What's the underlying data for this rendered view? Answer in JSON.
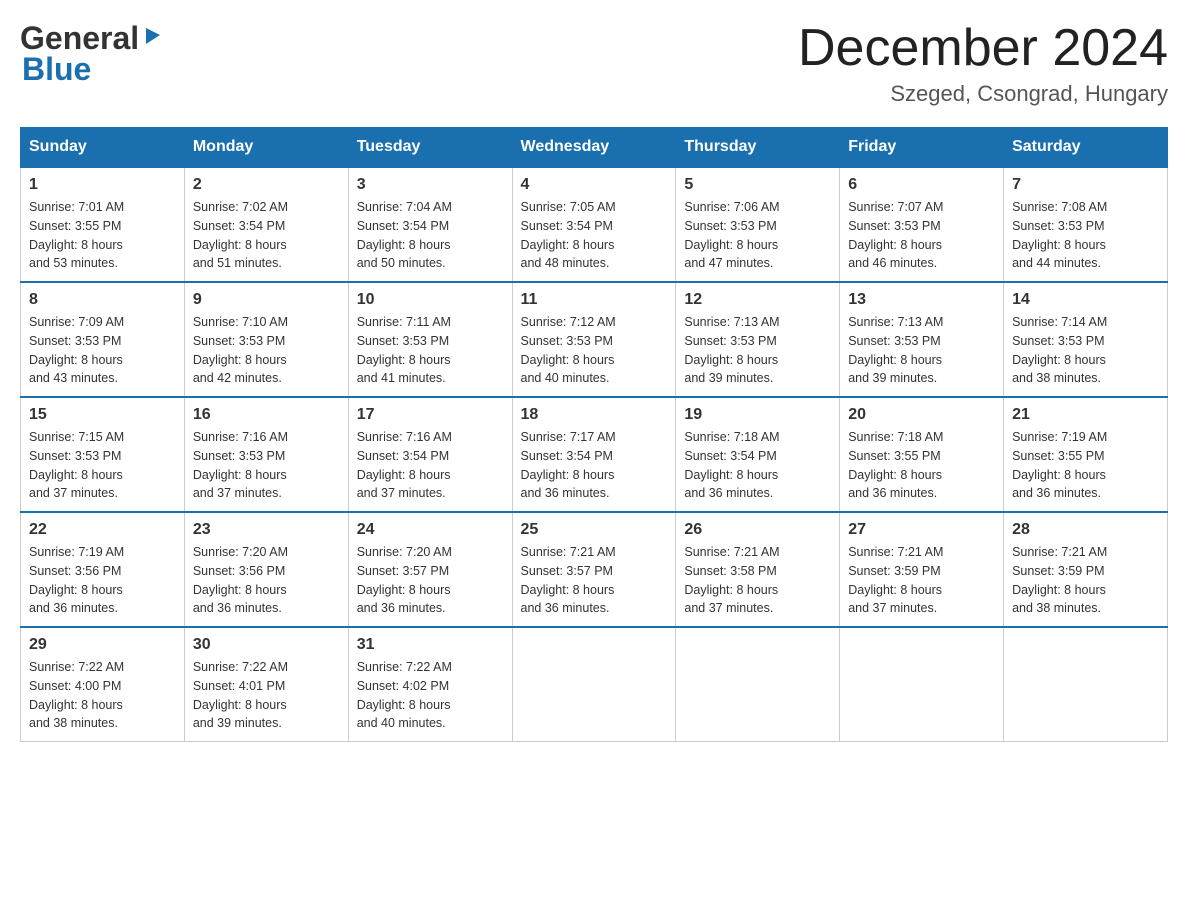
{
  "logo": {
    "general": "General",
    "blue": "Blue",
    "arrow": "▶"
  },
  "title": "December 2024",
  "location": "Szeged, Csongrad, Hungary",
  "days_header": [
    "Sunday",
    "Monday",
    "Tuesday",
    "Wednesday",
    "Thursday",
    "Friday",
    "Saturday"
  ],
  "weeks": [
    [
      {
        "date": "1",
        "sunrise": "7:01 AM",
        "sunset": "3:55 PM",
        "daylight": "8 hours and 53 minutes."
      },
      {
        "date": "2",
        "sunrise": "7:02 AM",
        "sunset": "3:54 PM",
        "daylight": "8 hours and 51 minutes."
      },
      {
        "date": "3",
        "sunrise": "7:04 AM",
        "sunset": "3:54 PM",
        "daylight": "8 hours and 50 minutes."
      },
      {
        "date": "4",
        "sunrise": "7:05 AM",
        "sunset": "3:54 PM",
        "daylight": "8 hours and 48 minutes."
      },
      {
        "date": "5",
        "sunrise": "7:06 AM",
        "sunset": "3:53 PM",
        "daylight": "8 hours and 47 minutes."
      },
      {
        "date": "6",
        "sunrise": "7:07 AM",
        "sunset": "3:53 PM",
        "daylight": "8 hours and 46 minutes."
      },
      {
        "date": "7",
        "sunrise": "7:08 AM",
        "sunset": "3:53 PM",
        "daylight": "8 hours and 44 minutes."
      }
    ],
    [
      {
        "date": "8",
        "sunrise": "7:09 AM",
        "sunset": "3:53 PM",
        "daylight": "8 hours and 43 minutes."
      },
      {
        "date": "9",
        "sunrise": "7:10 AM",
        "sunset": "3:53 PM",
        "daylight": "8 hours and 42 minutes."
      },
      {
        "date": "10",
        "sunrise": "7:11 AM",
        "sunset": "3:53 PM",
        "daylight": "8 hours and 41 minutes."
      },
      {
        "date": "11",
        "sunrise": "7:12 AM",
        "sunset": "3:53 PM",
        "daylight": "8 hours and 40 minutes."
      },
      {
        "date": "12",
        "sunrise": "7:13 AM",
        "sunset": "3:53 PM",
        "daylight": "8 hours and 39 minutes."
      },
      {
        "date": "13",
        "sunrise": "7:13 AM",
        "sunset": "3:53 PM",
        "daylight": "8 hours and 39 minutes."
      },
      {
        "date": "14",
        "sunrise": "7:14 AM",
        "sunset": "3:53 PM",
        "daylight": "8 hours and 38 minutes."
      }
    ],
    [
      {
        "date": "15",
        "sunrise": "7:15 AM",
        "sunset": "3:53 PM",
        "daylight": "8 hours and 37 minutes."
      },
      {
        "date": "16",
        "sunrise": "7:16 AM",
        "sunset": "3:53 PM",
        "daylight": "8 hours and 37 minutes."
      },
      {
        "date": "17",
        "sunrise": "7:16 AM",
        "sunset": "3:54 PM",
        "daylight": "8 hours and 37 minutes."
      },
      {
        "date": "18",
        "sunrise": "7:17 AM",
        "sunset": "3:54 PM",
        "daylight": "8 hours and 36 minutes."
      },
      {
        "date": "19",
        "sunrise": "7:18 AM",
        "sunset": "3:54 PM",
        "daylight": "8 hours and 36 minutes."
      },
      {
        "date": "20",
        "sunrise": "7:18 AM",
        "sunset": "3:55 PM",
        "daylight": "8 hours and 36 minutes."
      },
      {
        "date": "21",
        "sunrise": "7:19 AM",
        "sunset": "3:55 PM",
        "daylight": "8 hours and 36 minutes."
      }
    ],
    [
      {
        "date": "22",
        "sunrise": "7:19 AM",
        "sunset": "3:56 PM",
        "daylight": "8 hours and 36 minutes."
      },
      {
        "date": "23",
        "sunrise": "7:20 AM",
        "sunset": "3:56 PM",
        "daylight": "8 hours and 36 minutes."
      },
      {
        "date": "24",
        "sunrise": "7:20 AM",
        "sunset": "3:57 PM",
        "daylight": "8 hours and 36 minutes."
      },
      {
        "date": "25",
        "sunrise": "7:21 AM",
        "sunset": "3:57 PM",
        "daylight": "8 hours and 36 minutes."
      },
      {
        "date": "26",
        "sunrise": "7:21 AM",
        "sunset": "3:58 PM",
        "daylight": "8 hours and 37 minutes."
      },
      {
        "date": "27",
        "sunrise": "7:21 AM",
        "sunset": "3:59 PM",
        "daylight": "8 hours and 37 minutes."
      },
      {
        "date": "28",
        "sunrise": "7:21 AM",
        "sunset": "3:59 PM",
        "daylight": "8 hours and 38 minutes."
      }
    ],
    [
      {
        "date": "29",
        "sunrise": "7:22 AM",
        "sunset": "4:00 PM",
        "daylight": "8 hours and 38 minutes."
      },
      {
        "date": "30",
        "sunrise": "7:22 AM",
        "sunset": "4:01 PM",
        "daylight": "8 hours and 39 minutes."
      },
      {
        "date": "31",
        "sunrise": "7:22 AM",
        "sunset": "4:02 PM",
        "daylight": "8 hours and 40 minutes."
      },
      null,
      null,
      null,
      null
    ]
  ],
  "labels": {
    "sunrise": "Sunrise:",
    "sunset": "Sunset:",
    "daylight": "Daylight:"
  }
}
